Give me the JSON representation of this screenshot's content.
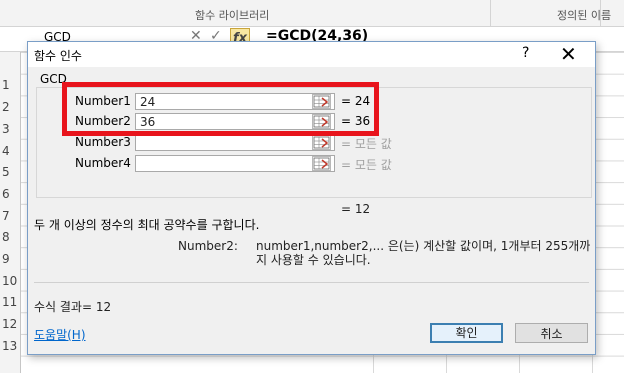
{
  "excel": {
    "ribbon_groups": [
      "함수 라이브러리",
      "정의된 이름"
    ],
    "name_box": "GCD",
    "formula": "=GCD(24,36)",
    "fx_label": "fx",
    "row_numbers": [
      "1",
      "2",
      "3",
      "4",
      "5",
      "6",
      "7",
      "8",
      "9",
      "10",
      "11",
      "12",
      "13",
      "14"
    ]
  },
  "dialog": {
    "title": "함수 인수",
    "help_label": "?",
    "close_label": "✕",
    "function_name": "GCD",
    "args": [
      {
        "label": "Number1",
        "value": "24",
        "result": "=  24"
      },
      {
        "label": "Number2",
        "value": "36",
        "result": "=  36"
      },
      {
        "label": "Number3",
        "value": "",
        "result": "=  모든 값"
      },
      {
        "label": "Number4",
        "value": "",
        "result": "=  모든 값"
      }
    ],
    "result_line": "=  12",
    "description": "두 개 이상의 정수의 최대 공약수를 구합니다.",
    "arg_desc_name": "Number2:",
    "arg_desc_text": "number1,number2,... 은(는) 계산할 값이며, 1개부터 255개까지 사용할 수 있습니다.",
    "formula_result": "수식 결과=  12",
    "help_link": "도움말(H)",
    "ok_label": "확인",
    "cancel_label": "취소"
  },
  "colors": {
    "highlight": "#e8141c",
    "link": "#0066cc",
    "dialog_border": "#7a9ec7"
  }
}
